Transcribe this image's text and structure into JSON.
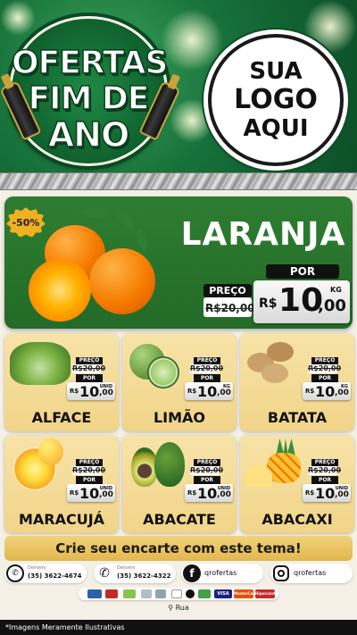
{
  "header": {
    "badge_lines": [
      "OFERTAS",
      "FIM DE",
      "ANO"
    ],
    "logo_lines": [
      "SUA",
      "LOGO",
      "AQUI"
    ]
  },
  "featured": {
    "discount": "-50%",
    "name": "LARANJA",
    "preco_label": "PREÇO",
    "old_price": "R$20,00",
    "por_label": "POR",
    "currency": "R$",
    "price_int": "10",
    "price_dec": ",00",
    "unit": "KG"
  },
  "products": [
    {
      "name": "ALFACE",
      "preco_label": "PREÇO",
      "old_price": "R$20,00",
      "por_label": "POR",
      "currency": "R$",
      "price_int": "10",
      "price_dec": ",00",
      "unit": "UNID"
    },
    {
      "name": "LIMÃO",
      "preco_label": "PREÇO",
      "old_price": "R$20,00",
      "por_label": "POR",
      "currency": "R$",
      "price_int": "10",
      "price_dec": ",00",
      "unit": "KG"
    },
    {
      "name": "BATATA",
      "preco_label": "PREÇO",
      "old_price": "R$20,00",
      "por_label": "POR",
      "currency": "R$",
      "price_int": "10",
      "price_dec": ",00",
      "unit": "KG"
    },
    {
      "name": "MARACUJÁ",
      "preco_label": "PREÇO",
      "old_price": "R$20,00",
      "por_label": "POR",
      "currency": "R$",
      "price_int": "10",
      "price_dec": ",00",
      "unit": "UNID"
    },
    {
      "name": "ABACATE",
      "preco_label": "PREÇO",
      "old_price": "R$20,00",
      "por_label": "POR",
      "currency": "R$",
      "price_int": "10",
      "price_dec": ",00",
      "unit": "UNID"
    },
    {
      "name": "ABACAXI",
      "preco_label": "PREÇO",
      "old_price": "R$20,00",
      "por_label": "POR",
      "currency": "R$",
      "price_int": "10",
      "price_dec": ",00",
      "unit": "UNID"
    }
  ],
  "cta": "Crie seu encarte com este tema!",
  "contacts": {
    "whatsapp": {
      "label": "Delivery",
      "value": "(35) 3622-4674",
      "icon": "whatsapp-icon"
    },
    "phone": {
      "label": "Delivery",
      "value": "(35) 3622-4322",
      "icon": "phone-icon"
    },
    "facebook": {
      "value": "qrofertas",
      "icon": "facebook-icon"
    },
    "instagram": {
      "value": "qrofertas",
      "icon": "instagram-icon"
    }
  },
  "payments": [
    "VISA",
    "MasterCard",
    "Hipercard"
  ],
  "address": "Rua",
  "footer": "*Imagens Meramente Ilustrativas",
  "colors": {
    "header_green": "#17703a",
    "featured_green": "#2e7d32",
    "card_yellow": "#f1d488",
    "cta_gold": "#e2b74e",
    "discount_orange": "#f0b020"
  }
}
